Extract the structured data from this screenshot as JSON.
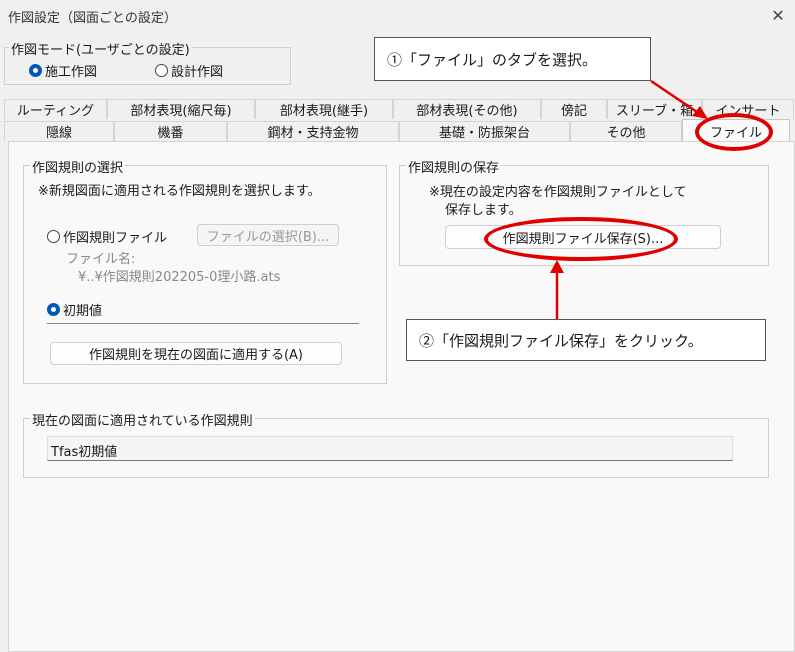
{
  "window": {
    "title": "作図設定（図面ごとの設定）",
    "close_glyph": "✕"
  },
  "mode_group": {
    "legend": "作図モード(ユーザごとの設定)",
    "options": [
      {
        "label": "施工作図",
        "selected": true
      },
      {
        "label": "設計作図",
        "selected": false
      }
    ]
  },
  "tabs_row1": [
    "ルーティング",
    "部材表現(縮尺毎)",
    "部材表現(継手)",
    "部材表現(その他)",
    "傍記",
    "スリーブ・箱",
    "インサート"
  ],
  "tabs_row2": [
    "隠線",
    "機番",
    "鋼材・支持金物",
    "基礎・防振架台",
    "その他",
    "ファイル"
  ],
  "active_tab": "ファイル",
  "select_group": {
    "legend": "作図規則の選択",
    "description": "※新規図面に適用される作図規則を選択します。",
    "file_option_label": "作図規則ファイル",
    "file_select_button": "ファイルの選択(B)...",
    "filename_label": "ファイル名:",
    "filename_value": "¥..¥作図規則202205-0理小路.ats",
    "default_option_label": "初期値",
    "file_option_selected": false,
    "default_option_selected": true,
    "apply_button": "作図規則を現在の図面に適用する(A)"
  },
  "save_group": {
    "legend": "作図規則の保存",
    "description_line1": "※現在の設定内容を作図規則ファイルとして",
    "description_line2": "保存します。",
    "save_button": "作図規則ファイル保存(S)..."
  },
  "current_group": {
    "legend": "現在の図面に適用されている作図規則",
    "value": "Tfas初期値"
  },
  "annotations": {
    "callout1": "①「ファイル」のタブを選択。",
    "callout2": "②「作図規則ファイル保存」をクリック。",
    "accent_color": "#e00000"
  }
}
